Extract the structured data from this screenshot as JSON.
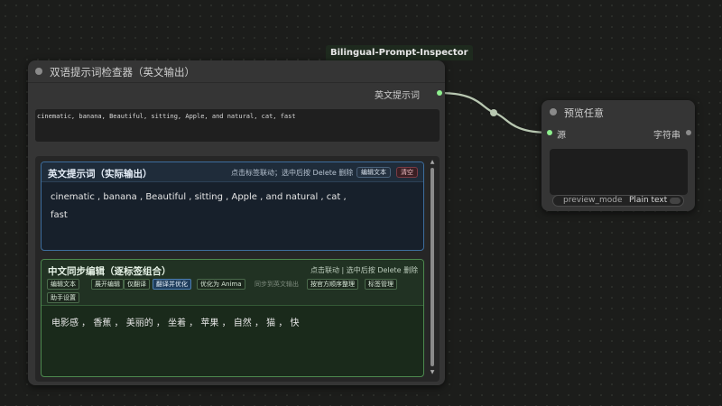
{
  "colors": {
    "canvas_bg": "#1c1d1b",
    "node_bg": "#353535",
    "link": "#b9c8b2",
    "slot_green": "#8ef08e",
    "slot_gray": "#8a8a8a",
    "en_panel_border": "#3d6e9e",
    "zh_panel_border": "#4d8a4f",
    "active_button": "#1f3d5c",
    "clear_button": "#7a3b44"
  },
  "inspector_node": {
    "badge": "Bilingual-Prompt-Inspector",
    "title": "双语提示词检查器（英文输出）",
    "output_label": "英文提示词",
    "output_text": "cinematic, banana, Beautiful, sitting, Apple, and natural, cat, fast",
    "english_panel": {
      "title": "英文提示词（实际输出）",
      "hint": "点击标签联动；选中后按 Delete 删除",
      "edit_button": "编辑文本",
      "clear_button": "清空",
      "tag_lines": [
        "cinematic ,  banana ,  Beautiful ,  sitting ,  Apple ,  and natural ,  cat ,",
        "fast"
      ]
    },
    "chinese_panel": {
      "title": "中文同步编辑（逐标签组合）",
      "hint": "点击联动 | 选中后按 Delete 删除",
      "buttons": [
        {
          "label": "编辑文本",
          "state": "normal"
        },
        {
          "label": "展开编辑",
          "state": "normal"
        },
        {
          "label": "仅翻译",
          "state": "normal"
        },
        {
          "label": "翻译并优化",
          "state": "active"
        },
        {
          "label": "优化为 Anima",
          "state": "normal"
        },
        {
          "label": "同步到英文输出",
          "state": "disabled"
        },
        {
          "label": "按官方顺序整理",
          "state": "normal"
        },
        {
          "label": "标签管理",
          "state": "normal"
        },
        {
          "label": "助手设置",
          "state": "normal"
        }
      ],
      "text": "电影感 ， 香蕉 ， 美丽的 ， 坐着 ， 苹果 ， 自然 ， 猫 ， 快"
    }
  },
  "preview_node": {
    "title": "预览任意",
    "input_label": "源",
    "output_label": "字符串",
    "widget_name": "preview_mode",
    "widget_value": "Plain text"
  }
}
